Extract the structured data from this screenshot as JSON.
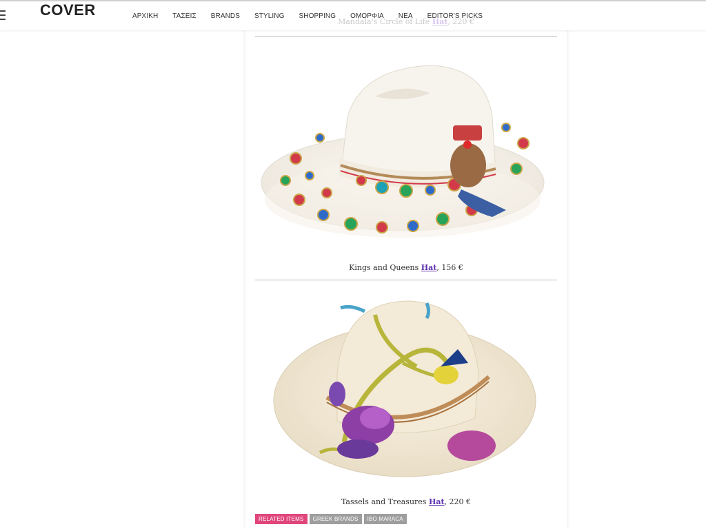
{
  "header": {
    "logo": "COVER",
    "nav": [
      "ΑΡΧΙΚΗ",
      "ΤΑΣΕΙΣ",
      "BRANDS",
      "STYLING",
      "SHOPPING",
      "ΟΜΟΡΦΙΑ",
      "ΝΕΑ",
      "EDITOR'S PICKS"
    ]
  },
  "items": [
    {
      "name": "Mandala's Circle of Life",
      "link": "Hat",
      "price": ", 220 €"
    },
    {
      "name": "Kings and Queens",
      "link": "Hat",
      "price": ", 156 €"
    },
    {
      "name": "Tassels and Treasures",
      "link": "Hat",
      "price": ", 220 €"
    }
  ],
  "tags": [
    {
      "label": "RELATED ITEMS",
      "color": "#e0457b"
    },
    {
      "label": "GREEK BRANDS",
      "color": "#9e9e9e"
    },
    {
      "label": "IBO MARACA",
      "color": "#9e9e9e"
    }
  ]
}
